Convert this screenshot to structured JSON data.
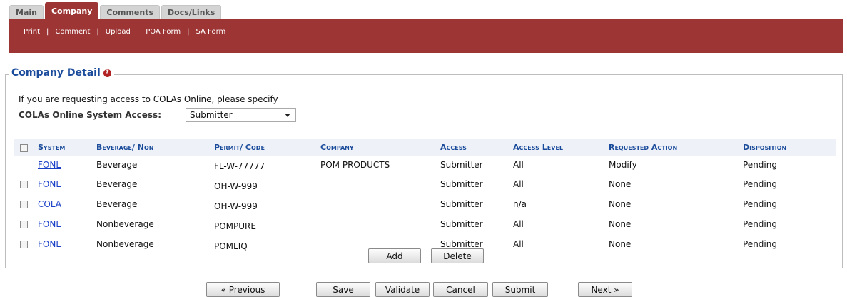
{
  "tabs": [
    "Main",
    "Company",
    "Comments",
    "Docs/Links"
  ],
  "actions": [
    "Print",
    "Comment",
    "Upload",
    "POA Form",
    "SA Form"
  ],
  "section": {
    "title": "Company Detail"
  },
  "intro": "If you are requesting access to COLAs Online, please specify",
  "access": {
    "label": "COLAs Online System Access:",
    "selected": "Submitter"
  },
  "table": {
    "headers": [
      "System",
      "Beverage/ Non",
      "Permit/ Code",
      "Company",
      "Access",
      "Access Level",
      "Requested Action",
      "Disposition"
    ],
    "rows": [
      {
        "system": "FONL",
        "bev": "Beverage",
        "permit": "FL-W-77777",
        "company": "POM PRODUCTS",
        "access": "Submitter",
        "level": "All",
        "action": "Modify",
        "disp": "Pending"
      },
      {
        "system": "FONL",
        "bev": "Beverage",
        "permit": "OH-W-999",
        "company": "",
        "access": "Submitter",
        "level": "All",
        "action": "None",
        "disp": "Pending"
      },
      {
        "system": "COLA",
        "bev": "Beverage",
        "permit": "OH-W-999",
        "company": "",
        "access": "Submitter",
        "level": "n/a",
        "action": "None",
        "disp": "Pending"
      },
      {
        "system": "FONL",
        "bev": "Nonbeverage",
        "permit": "POMPURE",
        "company": "",
        "access": "Submitter",
        "level": "All",
        "action": "None",
        "disp": "Pending"
      },
      {
        "system": "FONL",
        "bev": "Nonbeverage",
        "permit": "POMLIQ",
        "company": "",
        "access": "Submitter",
        "level": "All",
        "action": "None",
        "disp": "Pending"
      }
    ]
  },
  "buttons": {
    "add": "Add",
    "delete": "Delete",
    "previous": "« Previous",
    "save": "Save",
    "validate": "Validate",
    "cancel": "Cancel",
    "submit": "Submit",
    "next": "Next »"
  },
  "colors": {
    "brand": "#9e3535",
    "header_text": "#1b4b9b",
    "link": "#1a3fc7"
  }
}
